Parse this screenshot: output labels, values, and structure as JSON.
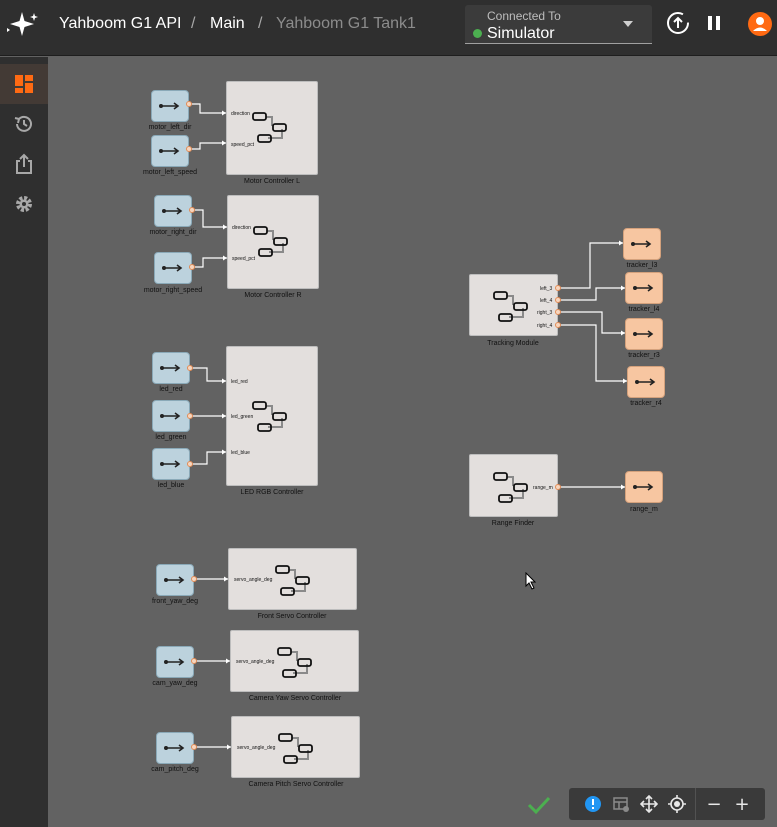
{
  "header": {
    "breadcrumb": [
      "Yahboom G1 API",
      "Main",
      "Yahboom G1 Tank1"
    ],
    "separator": "/",
    "connection_label": "Connected To",
    "connection_value": "Simulator",
    "connection_status_color": "#4caf50"
  },
  "icons": {
    "logo": "sparkle-logo-icon",
    "upload": "upload-circle-icon",
    "pause": "pause-icon",
    "user": "user-avatar-icon"
  },
  "sidebar": {
    "items": [
      {
        "name": "dashboard-icon",
        "active": true
      },
      {
        "name": "history-icon",
        "active": false
      },
      {
        "name": "export-icon",
        "active": false
      },
      {
        "name": "settings-icon",
        "active": false
      }
    ]
  },
  "graph": {
    "inputs": [
      "motor_left_dir",
      "motor_left_speed",
      "motor_right_dir",
      "motor_right_speed",
      "led_red",
      "led_green",
      "led_blue",
      "front_yaw_deg",
      "cam_yaw_deg",
      "cam_pitch_deg"
    ],
    "outputs": [
      "tracker_l3",
      "tracker_l4",
      "tracker_r3",
      "tracker_r4",
      "range_m"
    ],
    "components": [
      {
        "title": "Motor Controller L",
        "ports": [
          "direction",
          "speed_pct"
        ]
      },
      {
        "title": "Motor Controller R",
        "ports": [
          "direction",
          "speed_pct"
        ]
      },
      {
        "title": "LED RGB Controller",
        "ports": [
          "led_red",
          "led_green",
          "led_blue"
        ]
      },
      {
        "title": "Tracking Module",
        "ports": [
          "left_3",
          "left_4",
          "right_3",
          "right_4"
        ]
      },
      {
        "title": "Range Finder",
        "ports": [
          "range_m"
        ]
      },
      {
        "title": "Front Servo Controller",
        "ports": [
          "servo_angle_deg"
        ]
      },
      {
        "title": "Camera Yaw Servo Controller",
        "ports": [
          "servo_angle_deg"
        ]
      },
      {
        "title": "Camera Pitch Servo Controller",
        "ports": [
          "servo_angle_deg"
        ]
      }
    ]
  },
  "toolbar": {
    "zoom_out": "−",
    "zoom_in": "+",
    "items": [
      "info-icon",
      "layout-icon",
      "move-icon",
      "center-icon"
    ]
  },
  "colors": {
    "accent": "#ff6a13",
    "input_node": "#bcd2dd",
    "output_node": "#f7c6a1",
    "component_box": "#e3dfdd",
    "canvas": "#626262",
    "valid_check": "#4caf50"
  }
}
